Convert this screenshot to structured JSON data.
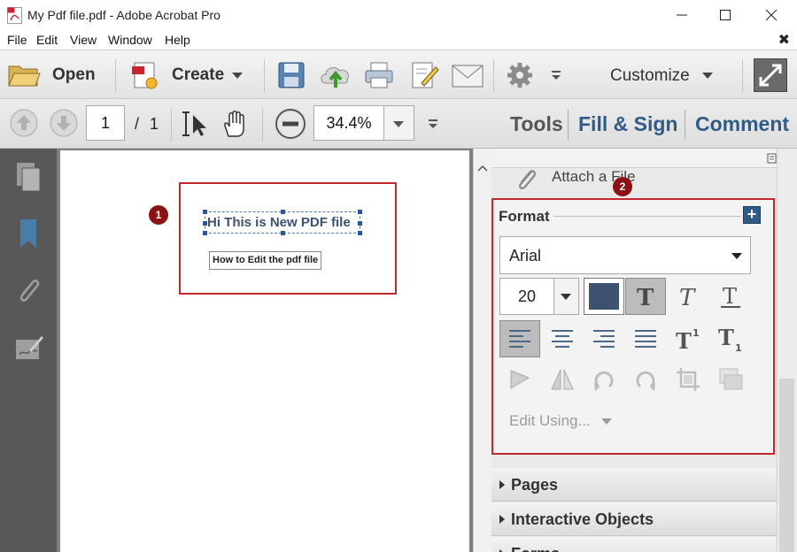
{
  "window": {
    "title": "My Pdf file.pdf - Adobe Acrobat Pro"
  },
  "menu": {
    "items": [
      "File",
      "Edit",
      "View",
      "Window",
      "Help"
    ],
    "close_doc": "✖"
  },
  "toolbar1": {
    "open_label": "Open",
    "create_label": "Create",
    "customize_label": "Customize"
  },
  "toolbar2": {
    "page_current": "1",
    "page_separator": "/",
    "page_total": "1",
    "zoom": "34.4%",
    "tabs": [
      "Tools",
      "Fill & Sign",
      "Comment"
    ]
  },
  "document": {
    "callout_1": "1",
    "title_text": "Hi This is New PDF file",
    "sub_text": "How to Edit the pdf file"
  },
  "panel": {
    "attach_label": "Attach a File",
    "callout_2": "2",
    "format_header": "Format",
    "font_name": "Arial",
    "font_size": "20",
    "edit_using": "Edit Using...",
    "sections": [
      "Pages",
      "Interactive Objects",
      "Forms"
    ]
  },
  "colors": {
    "accent_blue": "#2f5b86",
    "callout_red": "#8b1316",
    "highlight_red": "#c0282d",
    "text_color_swatch": "#3d5170"
  }
}
